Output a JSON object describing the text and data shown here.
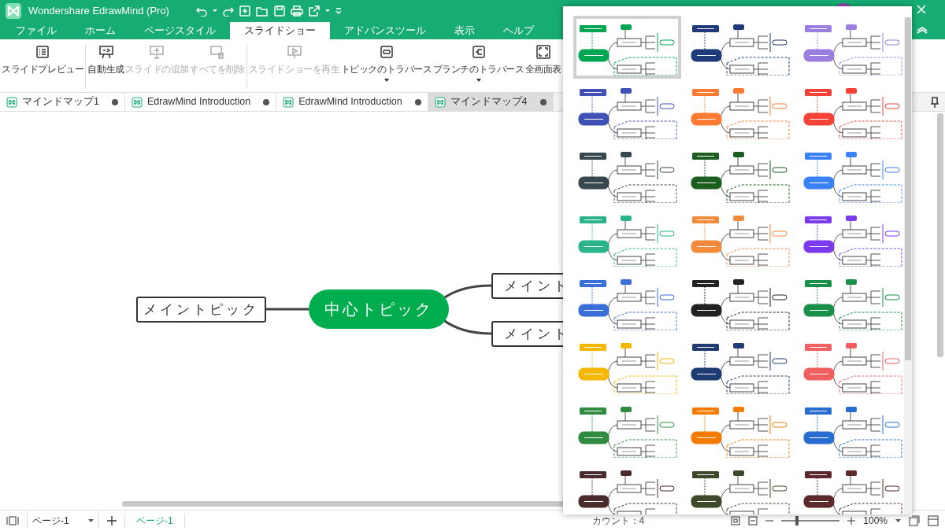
{
  "window": {
    "title": "Wondershare EdrawMind (Pro)"
  },
  "menu_tabs": [
    {
      "label": "ファイル",
      "selected": false
    },
    {
      "label": "ホーム",
      "selected": false
    },
    {
      "label": "ページスタイル",
      "selected": false
    },
    {
      "label": "スライドショー",
      "selected": true
    },
    {
      "label": "アドバンスツール",
      "selected": false
    },
    {
      "label": "表示",
      "selected": false
    },
    {
      "label": "ヘルプ",
      "selected": false
    }
  ],
  "ribbon": {
    "groups": [
      {
        "buttons": [
          {
            "kind": "preview",
            "label": "スライドプレビュー",
            "disabled": false
          }
        ]
      },
      {
        "buttons": [
          {
            "kind": "auto",
            "label": "自動生成",
            "disabled": false
          },
          {
            "kind": "add",
            "label": "スライドの追加",
            "disabled": true
          },
          {
            "kind": "delete",
            "label": "すべてを削除",
            "disabled": true
          }
        ]
      },
      {
        "buttons": [
          {
            "kind": "play",
            "label": "スライドショーを再生",
            "disabled": true
          },
          {
            "kind": "topic",
            "label": "トピックのトラバース",
            "disabled": false,
            "dropdown": true
          },
          {
            "kind": "branch",
            "label": "ブランチのトラバース",
            "disabled": false,
            "dropdown": true
          },
          {
            "kind": "fullscreen",
            "label": "全画面表",
            "disabled": false
          }
        ]
      }
    ]
  },
  "doc_tabs": [
    {
      "label": "マインドマップ1",
      "selected": false
    },
    {
      "label": "EdrawMind Introduction",
      "selected": false
    },
    {
      "label": "EdrawMind Introduction",
      "selected": false
    },
    {
      "label": "マインドマップ4",
      "selected": true
    }
  ],
  "canvas": {
    "central": "中心トピック",
    "topics": [
      {
        "label": "メイントピック",
        "kind": "left"
      },
      {
        "label": "メイント",
        "kind": "right"
      },
      {
        "label": "メイント",
        "kind": "right"
      }
    ]
  },
  "theme_panel": {
    "themes": [
      {
        "selected": true,
        "color": "#00a651"
      },
      {
        "selected": false,
        "color": "#1f3a7a"
      },
      {
        "selected": false,
        "color": "#9b7fe0"
      },
      {
        "selected": false,
        "color": "#3f51b5"
      },
      {
        "selected": false,
        "color": "#ff7a33"
      },
      {
        "selected": false,
        "color": "#f44336"
      },
      {
        "selected": false,
        "color": "#37474f"
      },
      {
        "selected": false,
        "color": "#1b5e20"
      },
      {
        "selected": false,
        "color": "#3b82f6"
      },
      {
        "selected": false,
        "color": "#2bb48c"
      },
      {
        "selected": false,
        "color": "#f28b3c"
      },
      {
        "selected": false,
        "color": "#7c3aed"
      },
      {
        "selected": false,
        "color": "#3b6fd8"
      },
      {
        "selected": false,
        "color": "#222222"
      },
      {
        "selected": false,
        "color": "#1a8f4a"
      },
      {
        "selected": false,
        "color": "#f5b800"
      },
      {
        "selected": false,
        "color": "#1f3b73"
      },
      {
        "selected": false,
        "color": "#f06060"
      },
      {
        "selected": false,
        "color": "#2e8b3f"
      },
      {
        "selected": false,
        "color": "#f57c00"
      },
      {
        "selected": false,
        "color": "#2a6dd0"
      },
      {
        "selected": false,
        "color": "#4a2a2a"
      },
      {
        "selected": false,
        "color": "#3d4a2a"
      },
      {
        "selected": false,
        "color": "#5c2a2a"
      }
    ]
  },
  "status_bar": {
    "page_select": "ページ-1",
    "page_tab": "ページ-1",
    "count": "カウント：4",
    "zoom": {
      "level": 0.25
    },
    "zoom_text": "100%"
  }
}
